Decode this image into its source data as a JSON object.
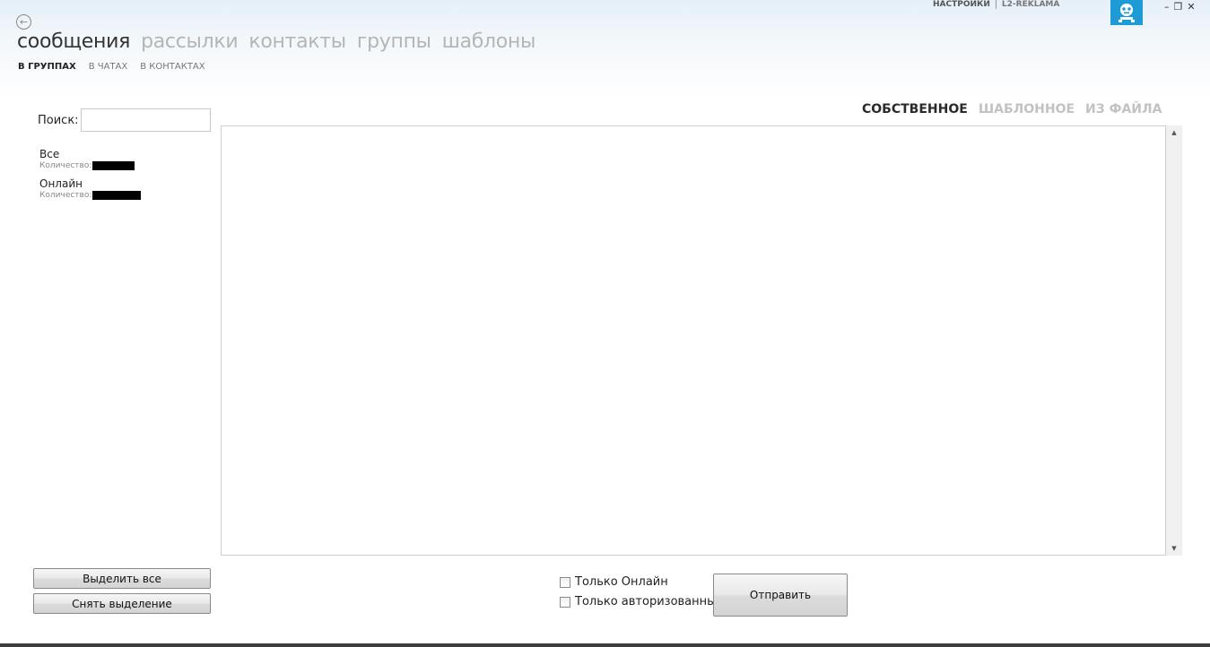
{
  "header": {
    "main_tabs": [
      "сообщения",
      "рассылки",
      "контакты",
      "группы",
      "шаблоны"
    ],
    "sub_tabs": [
      "В ГРУППАХ",
      "В ЧАТАХ",
      "В КОНТАКТАХ"
    ],
    "top_links": {
      "settings": "НАСТРОЙКИ",
      "account": "L2-REKLAMA"
    },
    "window_controls": {
      "minimize": "–",
      "restore": "❐",
      "close": "✕"
    },
    "back_icon": "arrow-left-circle-icon",
    "avatar_icon": "robot-avatar-icon",
    "accent_color": "#1e9ad6"
  },
  "sidebar": {
    "search_label": "Поиск:",
    "search_value": "",
    "groups": [
      {
        "name": "Все",
        "count_label": "Количество:"
      },
      {
        "name": "Онлайн",
        "count_label": "Количество:"
      }
    ],
    "select_all_label": "Выделить все",
    "deselect_label": "Снять выделение"
  },
  "message": {
    "tabs": [
      "СОБСТВЕННОЕ",
      "ШАБЛОННОЕ",
      "ИЗ ФАЙЛА"
    ],
    "active_tab": "СОБСТВЕННОЕ",
    "text": ""
  },
  "footer": {
    "only_online_label": "Только Онлайн",
    "only_online_checked": false,
    "only_authorized_label": "Только авторизованным",
    "only_authorized_checked": false,
    "send_label": "Отправить"
  }
}
